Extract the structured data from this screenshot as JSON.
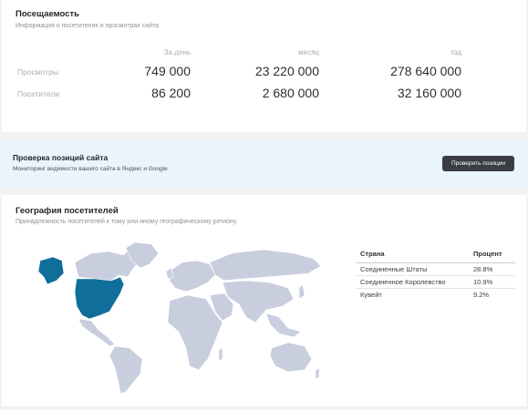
{
  "traffic": {
    "title": "Посещаемость",
    "subtitle": "Информация о посетителях и просмотрах сайта",
    "columns": [
      "За день",
      "месяц",
      "год"
    ],
    "rows": [
      {
        "label": "Просмотры",
        "values": [
          "749 000",
          "23 220 000",
          "278 640 000"
        ]
      },
      {
        "label": "Посетители",
        "values": [
          "86 200",
          "2 680 000",
          "32 160 000"
        ]
      }
    ]
  },
  "position_check": {
    "title": "Проверка позиций сайта",
    "subtitle": "Мониторинг видимости вашего сайта в Яндекс и Google",
    "button_label": "Проверить позиции"
  },
  "geography": {
    "title": "География посетителей",
    "subtitle": "Принадлежность посетителей к тому или иному географическому региону.",
    "colors": {
      "highlight": "#0f6e9a",
      "land": "#c8cedd"
    },
    "table": {
      "headers": [
        "Страна",
        "Процент"
      ],
      "rows": [
        {
          "country": "Соединенные Штаты",
          "percent": "28.8%"
        },
        {
          "country": "Соединенное Королевство",
          "percent": "10.9%"
        },
        {
          "country": "Кувейт",
          "percent": "9.2%"
        }
      ]
    }
  }
}
